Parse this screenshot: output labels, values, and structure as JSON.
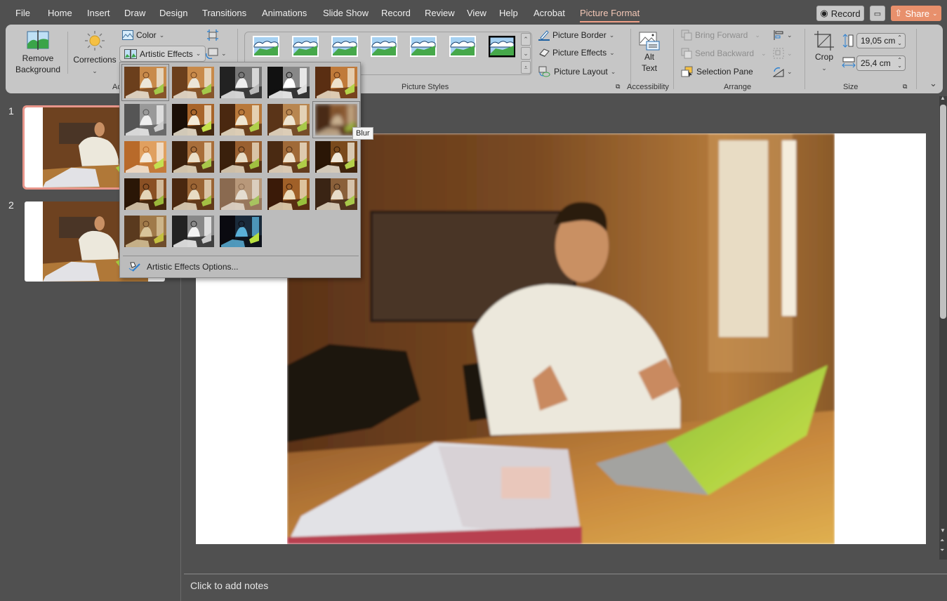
{
  "menubar": {
    "tabs": [
      "File",
      "Home",
      "Insert",
      "Draw",
      "Design",
      "Transitions",
      "Animations",
      "Slide Show",
      "Record",
      "Review",
      "View",
      "Help",
      "Acrobat",
      "Picture Format"
    ],
    "active_tab": "Picture Format",
    "record_label": "Record",
    "share_label": "Share"
  },
  "ribbon": {
    "remove_background": "Remove Background",
    "corrections": "Corrections",
    "color": "Color",
    "artistic_effects": "Artistic Effects",
    "adjust_group_partial": "Ac",
    "picture_styles_label": "Picture Styles",
    "picture_border": "Picture Border",
    "picture_effects": "Picture Effects",
    "picture_layout": "Picture Layout",
    "alt_text_line1": "Alt",
    "alt_text_line2": "Text",
    "accessibility_label": "Accessibility",
    "bring_forward": "Bring Forward",
    "send_backward": "Send Backward",
    "selection_pane": "Selection Pane",
    "arrange_label": "Arrange",
    "crop": "Crop",
    "height_value": "19,05 cm",
    "width_value": "25,4 cm",
    "size_label": "Size"
  },
  "slides": [
    {
      "number": "1",
      "selected": true
    },
    {
      "number": "2",
      "selected": false
    }
  ],
  "artistic_effects": {
    "rows": 5,
    "count": 23,
    "selected_index": 0,
    "hovered_index": 9,
    "tooltip": "Blur",
    "options_label": "Artistic Effects Options..."
  },
  "notes": {
    "placeholder": "Click to add notes"
  },
  "colors": {
    "accent": "#e8906c",
    "active_tab": "#f3c7b6",
    "selected_slide_border": "#e8958a"
  }
}
